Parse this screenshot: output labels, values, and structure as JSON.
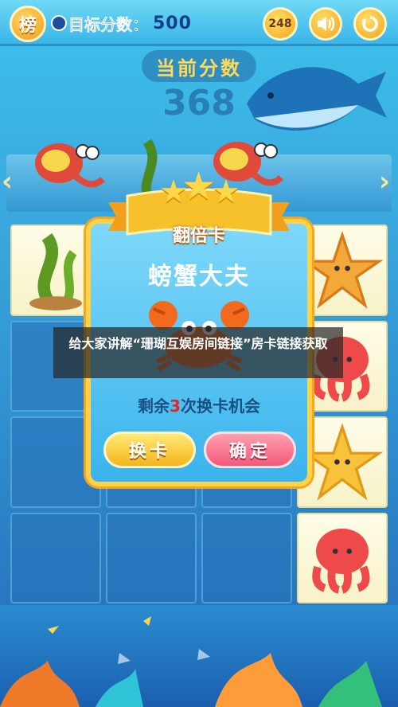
{
  "topbar": {
    "rank_icon_text": "榜",
    "target_label": "目标分数：",
    "target_value": "500",
    "moves_badge": "248",
    "sound_icon": "speaker-icon",
    "restart_icon": "restart-icon"
  },
  "header": {
    "current_score_label": "当前分数",
    "current_score_value": "368"
  },
  "modal": {
    "ribbon_title": "翻倍卡",
    "card_name": "螃蟹大夫",
    "chances_prefix": "剩余",
    "chances_count": "3",
    "chances_suffix": "次换卡机会",
    "switch_button": "换卡",
    "confirm_button": "确定"
  },
  "caption": {
    "text": "给大家讲解“珊瑚互娱房间链接”房卡链接获取"
  },
  "colors": {
    "accent_gold": "#ffd24a",
    "modal_blue": "#3ab4ec",
    "confirm_pink": "#f2597a",
    "chance_red": "#e02727"
  }
}
